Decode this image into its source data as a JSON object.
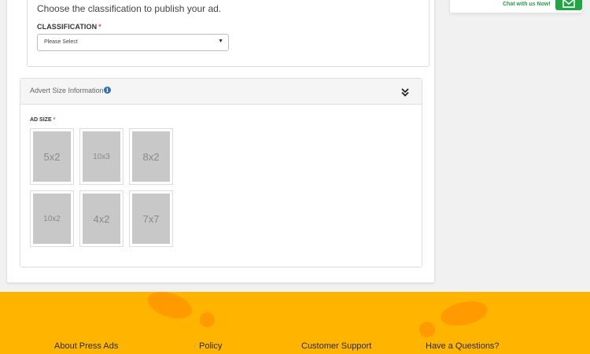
{
  "classification_panel": {
    "intro": "Choose the classification to publish your ad.",
    "label": "CLASSIFICATION",
    "required_mark": "*",
    "select_value": "Please Select"
  },
  "advert_size": {
    "title": "Advert Size Information",
    "info_icon": "i",
    "label": "AD SIZE",
    "required_mark": "*",
    "options": [
      "5x2",
      "10x3",
      "8x2",
      "10x2",
      "4x2",
      "7x7"
    ]
  },
  "chat": {
    "text": "Chat with us Now!",
    "icon": "envelope-icon",
    "accent": "#22a447"
  },
  "footer": {
    "background": "#ffb400",
    "columns": [
      "About Press Ads",
      "Policy",
      "Customer Support",
      "Have a Questions?"
    ]
  }
}
